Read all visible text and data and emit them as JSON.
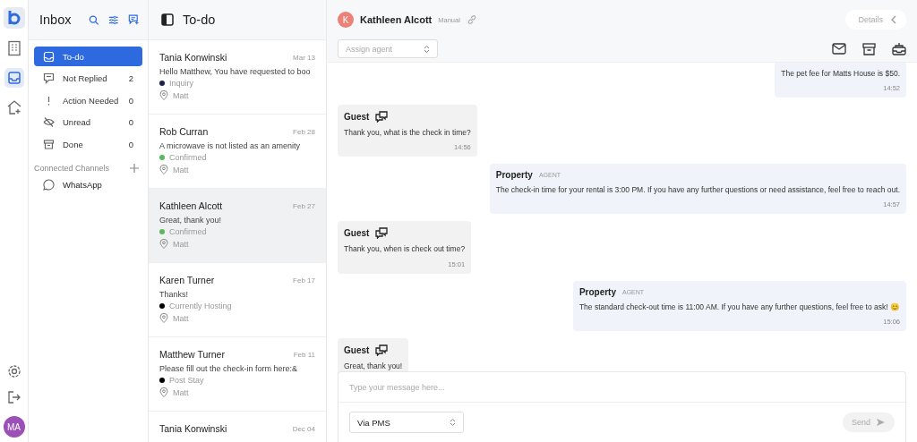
{
  "rail": {
    "avatar": "MA"
  },
  "inbox": {
    "title": "Inbox",
    "folders": [
      {
        "label": "To-do",
        "selected": true
      },
      {
        "label": "Not Replied",
        "count": "2",
        "selected": false
      },
      {
        "label": "Action Needed",
        "count": "0",
        "selected": false
      },
      {
        "label": "Unread",
        "count": "0",
        "selected": false
      },
      {
        "label": "Done",
        "count": "0",
        "selected": false
      }
    ],
    "channels_title": "Connected Channels",
    "channels": [
      "WhatsApp"
    ]
  },
  "list": {
    "title": "To-do",
    "items": [
      {
        "name": "Tania Konwinski",
        "date": "Mar 13",
        "preview": "Hello Matthew, You have requested to boo",
        "status": "Inquiry",
        "color": "#1b2048",
        "agent": "Matt",
        "selected": false
      },
      {
        "name": "Rob Curran",
        "date": "Feb 28",
        "preview": "A microwave is not listed as an amenity",
        "status": "Confirmed",
        "color": "#5cb85c",
        "agent": "Matt",
        "selected": false
      },
      {
        "name": "Kathleen Alcott",
        "date": "Feb 27",
        "preview": "Great, thank you!",
        "status": "Confirmed",
        "color": "#5cb85c",
        "agent": "Matt",
        "selected": true
      },
      {
        "name": "Karen Turner",
        "date": "Feb 17",
        "preview": "Thanks!",
        "status": "Currently Hosting",
        "color": "#000000",
        "agent": "Matt",
        "selected": false
      },
      {
        "name": "Matthew Turner",
        "date": "Feb 11",
        "preview": "Please fill out the check-in form here:&",
        "status": "Post Stay",
        "color": "#000000",
        "agent": "Matt",
        "selected": false
      },
      {
        "name": "Tania Konwinski",
        "date": "Dec 04",
        "selected": false
      }
    ]
  },
  "chat": {
    "initial": "K",
    "name": "Kathleen Alcott",
    "mode": "Manual",
    "details": "Details",
    "assign_placeholder": "Assign agent",
    "messages": [
      {
        "kind": "agent",
        "text": "The pet fee for Matts House is $50.",
        "time": "14:52"
      },
      {
        "kind": "guest",
        "sender": "Guest",
        "text": "Thank you, what is the check in time?",
        "time": "14:56"
      },
      {
        "kind": "agent",
        "sender": "Property",
        "tag": "AGENT",
        "text": "The check-in time for your rental is 3:00 PM. If you have any further questions or need assistance, feel free to reach out.",
        "time": "14:57"
      },
      {
        "kind": "guest",
        "sender": "Guest",
        "text": "Thank you, when is check out time?",
        "time": "15:01"
      },
      {
        "kind": "agent",
        "sender": "Property",
        "tag": "AGENT",
        "text": "The standard check-out time is 11:00 AM. If you have any further questions, feel free to ask! 😊",
        "time": "15:06"
      },
      {
        "kind": "guest",
        "sender": "Guest",
        "text": "Great, thank you!"
      }
    ],
    "composer": {
      "placeholder": "Type your message here...",
      "via": "Via PMS",
      "send": "Send"
    }
  }
}
